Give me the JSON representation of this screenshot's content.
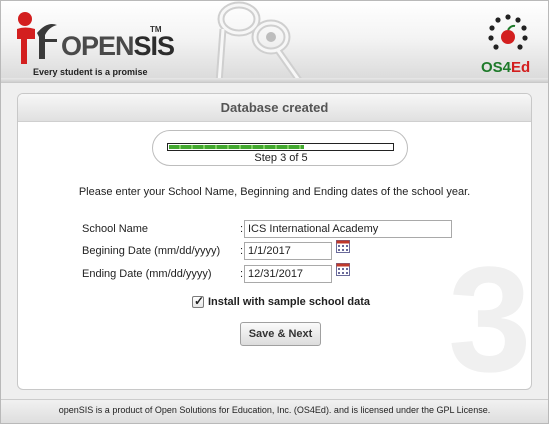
{
  "brand": {
    "logo_word_open": "OPEN",
    "logo_word_sis": "SIS",
    "logo_tm": "TM",
    "tagline": "Every student is a promise",
    "partner_os4": "OS4",
    "partner_ed": "Ed",
    "accent_green": "#1e7a2a",
    "accent_red": "#d31f1f"
  },
  "panel": {
    "title": "Database created",
    "watermark": "3"
  },
  "progress": {
    "step_label": "Step 3 of 5",
    "current_step": 3,
    "total_steps": 5,
    "fill_fraction": 0.6,
    "fill_color": "#43a830"
  },
  "form": {
    "instruction": "Please enter your School Name, Beginning and Ending dates of the school year.",
    "school_name_label": "School Name",
    "school_name_value": "ICS International Academy",
    "begin_date_label": "Begining Date (mm/dd/yyyy)",
    "begin_date_value": "1/1/2017",
    "end_date_label": "Ending Date (mm/dd/yyyy)",
    "end_date_value": "12/31/2017",
    "colon": ":",
    "sample_data_label": "Install with sample school data",
    "sample_data_checked": true,
    "submit_label": "Save & Next"
  },
  "footer": {
    "text": "openSIS is a product of Open Solutions for Education, Inc. (OS4Ed). and is licensed under the GPL License."
  }
}
